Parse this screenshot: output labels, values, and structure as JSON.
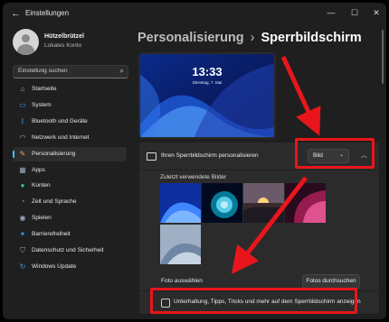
{
  "window": {
    "title": "Einstellungen",
    "controls": [
      "—",
      "☐",
      "✕"
    ]
  },
  "user": {
    "name": "Hützelbrützel",
    "account": "Lokales Konto"
  },
  "search": {
    "placeholder": "Einstellung suchen"
  },
  "nav": [
    {
      "label": "Startseite",
      "icon": "home-icon",
      "glyph": "⌂",
      "color": "#e0a35a",
      "active": false
    },
    {
      "label": "System",
      "icon": "monitor-icon",
      "glyph": "▭",
      "color": "#3aa0ff",
      "active": false
    },
    {
      "label": "Bluetooth und Geräte",
      "icon": "bluetooth-icon",
      "glyph": "ᛒ",
      "color": "#3aa0ff",
      "active": false
    },
    {
      "label": "Netzwerk und Internet",
      "icon": "wifi-icon",
      "glyph": "◠",
      "color": "#9fb7d8",
      "active": false
    },
    {
      "label": "Personalisierung",
      "icon": "brush-icon",
      "glyph": "✎",
      "color": "#f0a04b",
      "active": true
    },
    {
      "label": "Apps",
      "icon": "apps-icon",
      "glyph": "▦",
      "color": "#9aa8b8",
      "active": false
    },
    {
      "label": "Konten",
      "icon": "account-icon",
      "glyph": "●",
      "color": "#3dc17b",
      "active": false
    },
    {
      "label": "Zeit und Sprache",
      "icon": "globe-clock-icon",
      "glyph": "◔",
      "color": "#3aa0ff",
      "active": false
    },
    {
      "label": "Spielen",
      "icon": "gamepad-icon",
      "glyph": "◉",
      "color": "#9aa8b8",
      "active": false
    },
    {
      "label": "Barrierefreiheit",
      "icon": "accessibility-icon",
      "glyph": "✦",
      "color": "#3aa0ff",
      "active": false
    },
    {
      "label": "Datenschutz und Sicherheit",
      "icon": "shield-icon",
      "glyph": "⛉",
      "color": "#9aa8b8",
      "active": false
    },
    {
      "label": "Windows Update",
      "icon": "update-icon",
      "glyph": "↻",
      "color": "#3aa0ff",
      "active": false
    }
  ],
  "breadcrumb": {
    "parent": "Personalisierung",
    "separator": "›",
    "current": "Sperrbildschirm"
  },
  "preview": {
    "time": "13:33",
    "date": "Dienstag, 7. Mai"
  },
  "lockscreen": {
    "label": "Ihren Sperrbildschirm personalisieren",
    "dropdown_value": "Bild",
    "recent_label": "Zuletzt verwendete Bilder",
    "photo_label": "Foto auswählen",
    "browse_label": "Fotos durchsuchen",
    "checkbox_label": "Unterhaltung, Tipps, Tricks und mehr auf dem Sperrbildschirm anzeigen",
    "checkbox_checked": false
  },
  "colors": {
    "accent": "#4cc2ff",
    "annotation": "#e8161c"
  }
}
